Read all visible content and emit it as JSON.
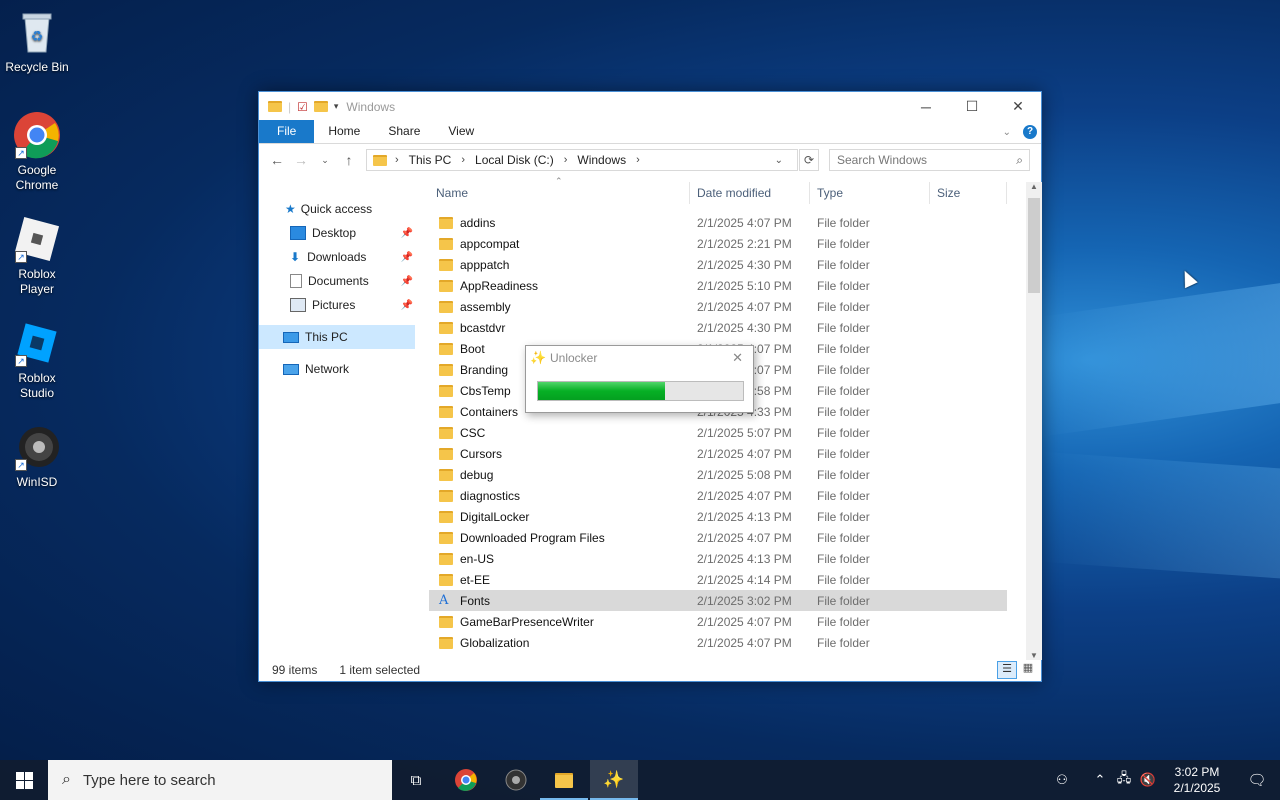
{
  "desktop": {
    "icons": [
      {
        "label": "Recycle Bin",
        "icon": "recycle-bin-icon"
      },
      {
        "label": "Google Chrome",
        "icon": "chrome-icon"
      },
      {
        "label": "Roblox Player",
        "icon": "roblox-player-icon"
      },
      {
        "label": "Roblox Studio",
        "icon": "roblox-studio-icon"
      },
      {
        "label": "WinISD",
        "icon": "winisd-icon"
      }
    ]
  },
  "explorer": {
    "title": "Windows",
    "ribbon_tabs": [
      "File",
      "Home",
      "Share",
      "View"
    ],
    "breadcrumb": [
      "This PC",
      "Local Disk (C:)",
      "Windows"
    ],
    "search_placeholder": "Search Windows",
    "sidebar": [
      {
        "label": "Quick access",
        "icon": "star-icon"
      },
      {
        "label": "Desktop",
        "icon": "desktop-icon",
        "pinned": true
      },
      {
        "label": "Downloads",
        "icon": "download-icon",
        "pinned": true
      },
      {
        "label": "Documents",
        "icon": "documents-icon",
        "pinned": true
      },
      {
        "label": "Pictures",
        "icon": "pictures-icon",
        "pinned": true
      },
      {
        "label": "This PC",
        "icon": "computer-icon",
        "selected": true
      },
      {
        "label": "Network",
        "icon": "network-icon"
      }
    ],
    "columns": [
      "Name",
      "Date modified",
      "Type",
      "Size"
    ],
    "rows": [
      {
        "name": "addins",
        "date": "2/1/2025 4:07 PM",
        "type": "File folder"
      },
      {
        "name": "appcompat",
        "date": "2/1/2025 2:21 PM",
        "type": "File folder"
      },
      {
        "name": "apppatch",
        "date": "2/1/2025 4:30 PM",
        "type": "File folder"
      },
      {
        "name": "AppReadiness",
        "date": "2/1/2025 5:10 PM",
        "type": "File folder"
      },
      {
        "name": "assembly",
        "date": "2/1/2025 4:07 PM",
        "type": "File folder"
      },
      {
        "name": "bcastdvr",
        "date": "2/1/2025 4:30 PM",
        "type": "File folder"
      },
      {
        "name": "Boot",
        "date": "2/1/2025 4:07 PM",
        "type": "File folder"
      },
      {
        "name": "Branding",
        "date": "2/1/2025 4:07 PM",
        "type": "File folder"
      },
      {
        "name": "CbsTemp",
        "date": "2/1/2025 2:58 PM",
        "type": "File folder"
      },
      {
        "name": "Containers",
        "date": "2/1/2025 4:33 PM",
        "type": "File folder"
      },
      {
        "name": "CSC",
        "date": "2/1/2025 5:07 PM",
        "type": "File folder"
      },
      {
        "name": "Cursors",
        "date": "2/1/2025 4:07 PM",
        "type": "File folder"
      },
      {
        "name": "debug",
        "date": "2/1/2025 5:08 PM",
        "type": "File folder"
      },
      {
        "name": "diagnostics",
        "date": "2/1/2025 4:07 PM",
        "type": "File folder"
      },
      {
        "name": "DigitalLocker",
        "date": "2/1/2025 4:13 PM",
        "type": "File folder"
      },
      {
        "name": "Downloaded Program Files",
        "date": "2/1/2025 4:07 PM",
        "type": "File folder"
      },
      {
        "name": "en-US",
        "date": "2/1/2025 4:13 PM",
        "type": "File folder"
      },
      {
        "name": "et-EE",
        "date": "2/1/2025 4:14 PM",
        "type": "File folder"
      },
      {
        "name": "Fonts",
        "date": "2/1/2025 3:02 PM",
        "type": "File folder",
        "selected": true,
        "font_icon": true
      },
      {
        "name": "GameBarPresenceWriter",
        "date": "2/1/2025 4:07 PM",
        "type": "File folder"
      },
      {
        "name": "Globalization",
        "date": "2/1/2025 4:07 PM",
        "type": "File folder"
      }
    ],
    "status": {
      "items": "99 items",
      "selected": "1 item selected"
    }
  },
  "dialog": {
    "title": "Unlocker",
    "progress": 0.62,
    "progress_color": "#06b025"
  },
  "taskbar": {
    "search_placeholder": "Type here to search",
    "time": "3:02 PM",
    "date": "2/1/2025"
  }
}
